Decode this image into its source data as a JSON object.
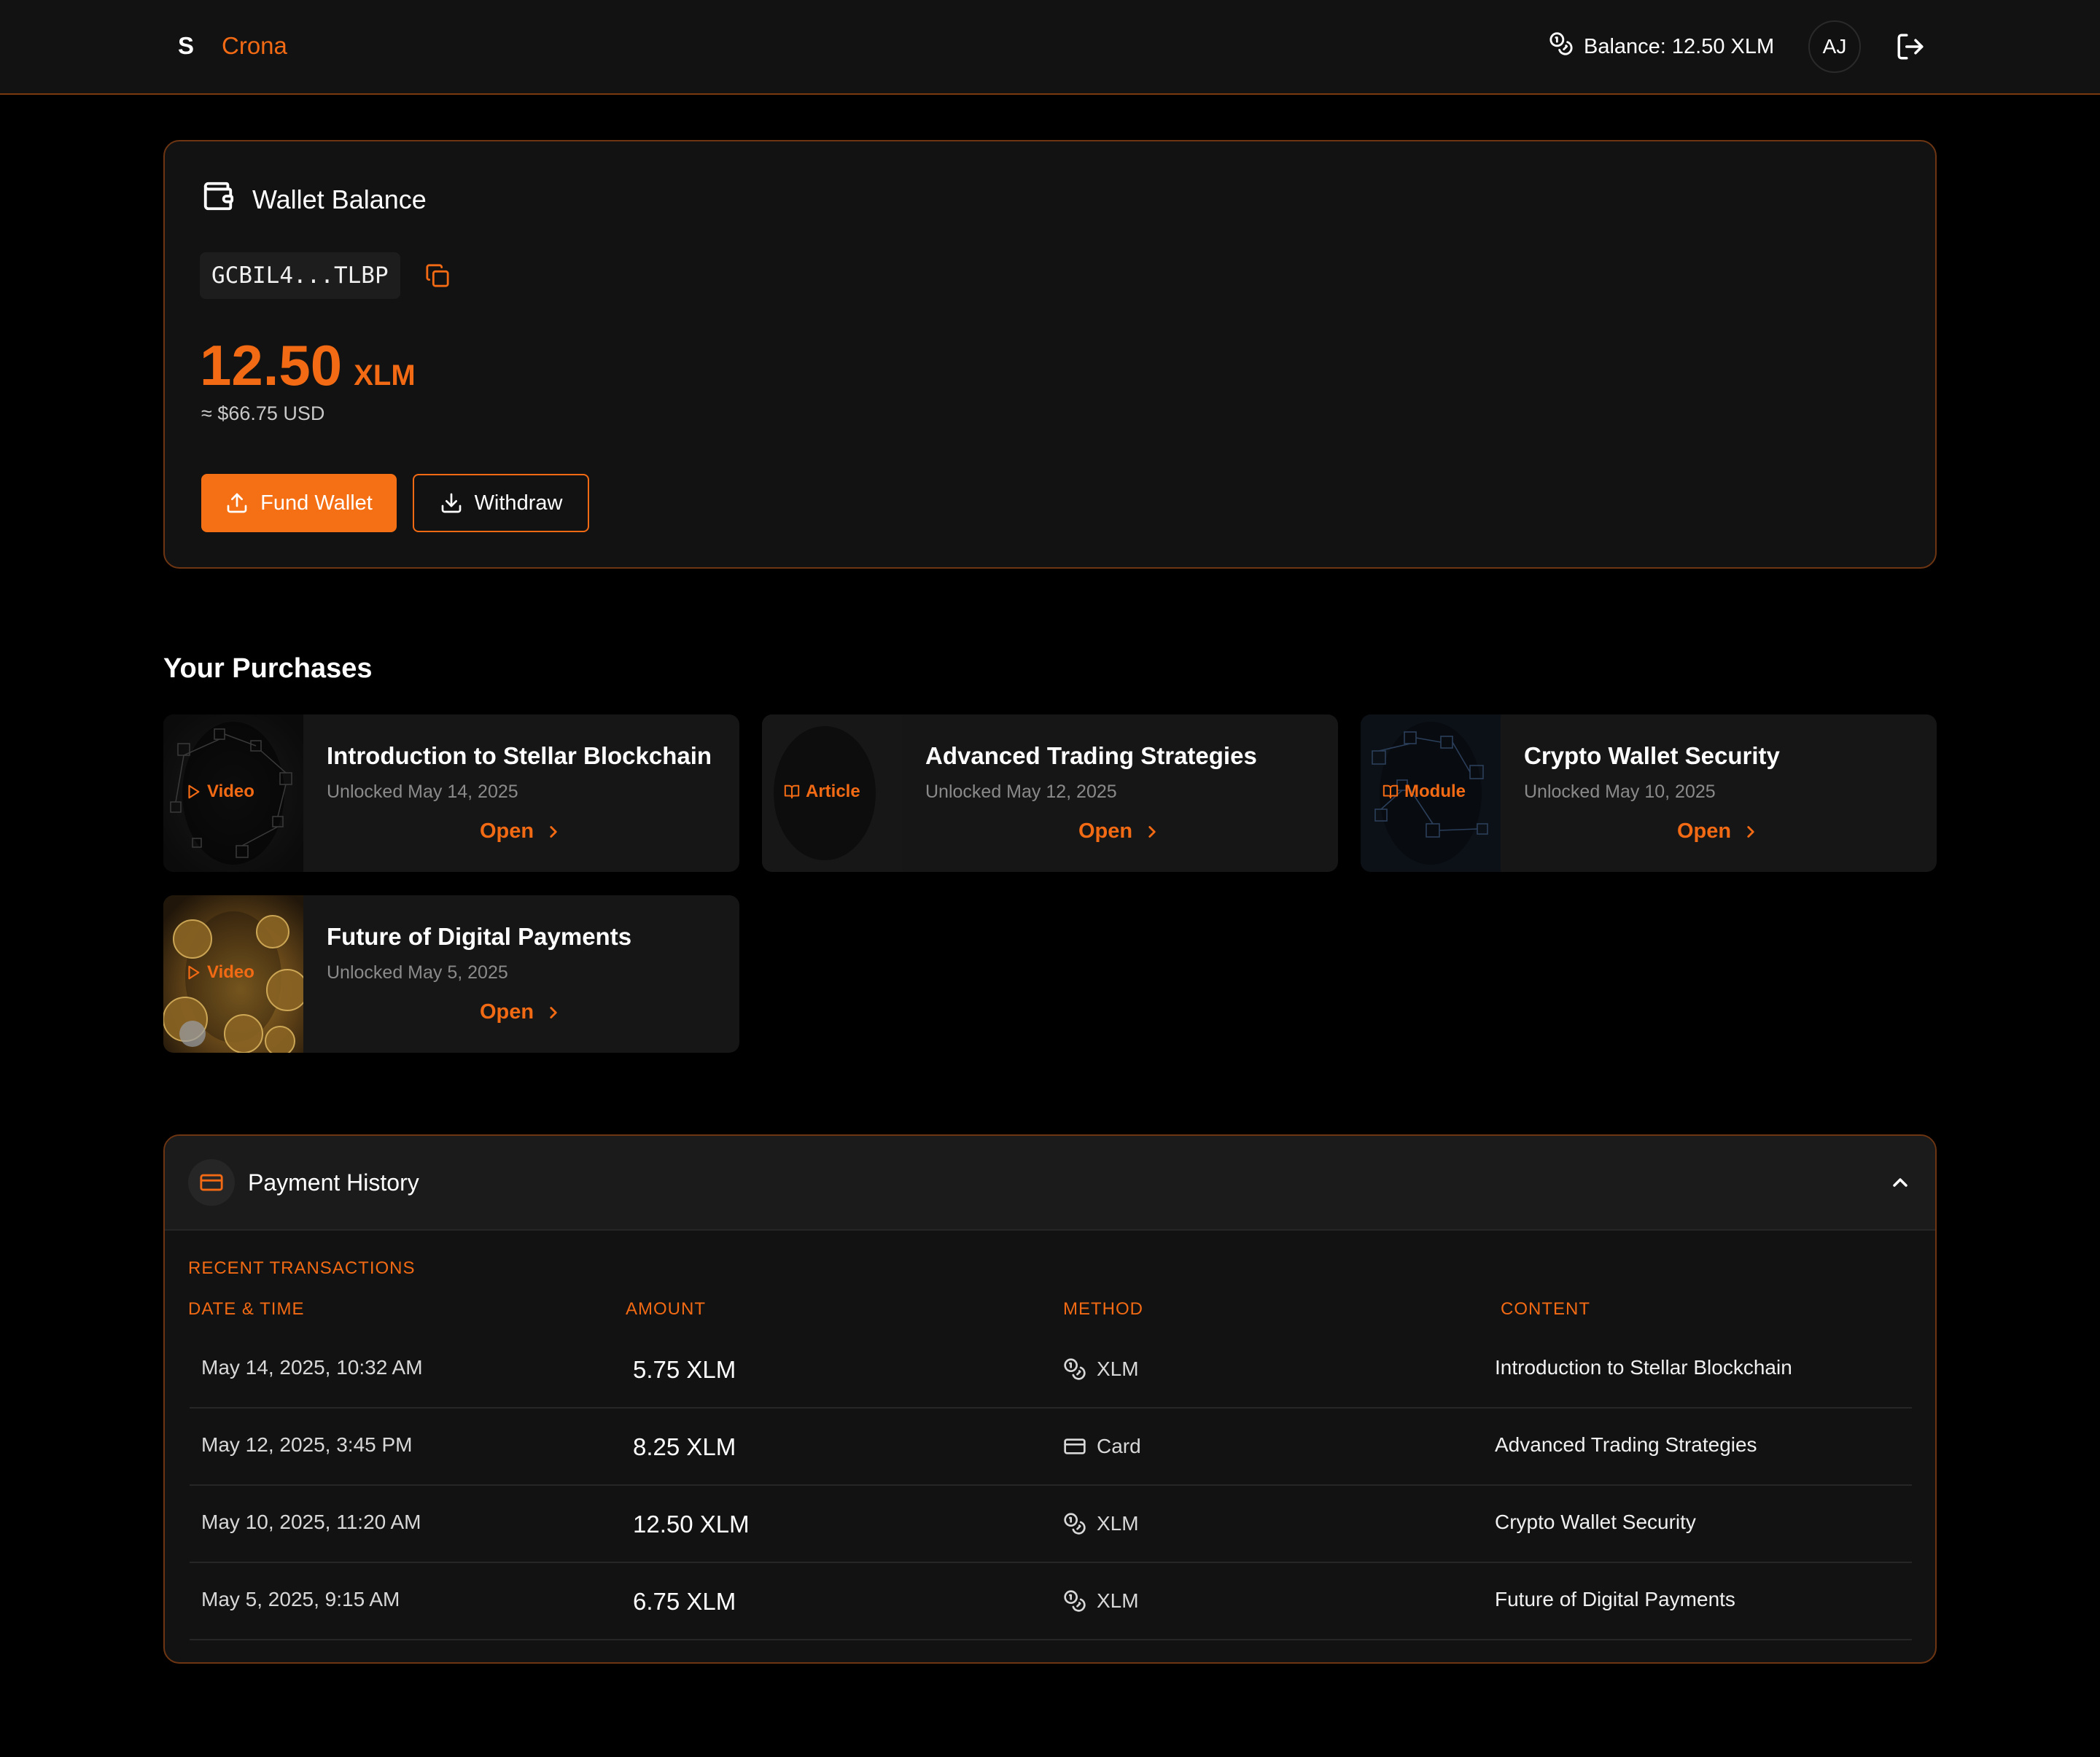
{
  "header": {
    "logo_mark": "S",
    "brand": "Crona",
    "balance": "Balance: 12.50 XLM",
    "avatar_initials": "AJ"
  },
  "wallet": {
    "title": "Wallet Balance",
    "address": "GCBIL4...TLBP",
    "amount": "12.50",
    "unit": "XLM",
    "usd": "≈ $66.75 USD",
    "fund_label": "Fund Wallet",
    "withdraw_label": "Withdraw"
  },
  "purchases": {
    "title": "Your Purchases",
    "open_label": "Open",
    "items": [
      {
        "title": "Introduction to Stellar Blockchain",
        "date": "Unlocked May 14, 2025",
        "type": "Video",
        "thumb": "network-dark"
      },
      {
        "title": "Advanced Trading Strategies",
        "date": "Unlocked May 12, 2025",
        "type": "Article",
        "thumb": "plain-dark"
      },
      {
        "title": "Crypto Wallet Security",
        "date": "Unlocked May 10, 2025",
        "type": "Module",
        "thumb": "network-blue"
      },
      {
        "title": "Future of Digital Payments",
        "date": "Unlocked May 5, 2025",
        "type": "Video",
        "thumb": "coins-gold"
      }
    ]
  },
  "history": {
    "title": "Payment History",
    "recent_label": "RECENT TRANSACTIONS",
    "columns": [
      "DATE & TIME",
      "AMOUNT",
      "METHOD",
      "CONTENT"
    ],
    "rows": [
      {
        "date": "May 14, 2025, 10:32 AM",
        "amount": "5.75 XLM",
        "method": "XLM",
        "method_icon": "coins-icon",
        "content": "Introduction to Stellar Blockchain"
      },
      {
        "date": "May 12, 2025, 3:45 PM",
        "amount": "8.25 XLM",
        "method": "Card",
        "method_icon": "card-icon",
        "content": "Advanced Trading Strategies"
      },
      {
        "date": "May 10, 2025, 11:20 AM",
        "amount": "12.50 XLM",
        "method": "XLM",
        "method_icon": "coins-icon",
        "content": "Crypto Wallet Security"
      },
      {
        "date": "May 5, 2025, 9:15 AM",
        "amount": "6.75 XLM",
        "method": "XLM",
        "method_icon": "coins-icon",
        "content": "Future of Digital Payments"
      }
    ]
  },
  "colors": {
    "accent": "#f26a14",
    "background": "#000000",
    "surface": "#121212",
    "border_accent": "#6d3512"
  }
}
